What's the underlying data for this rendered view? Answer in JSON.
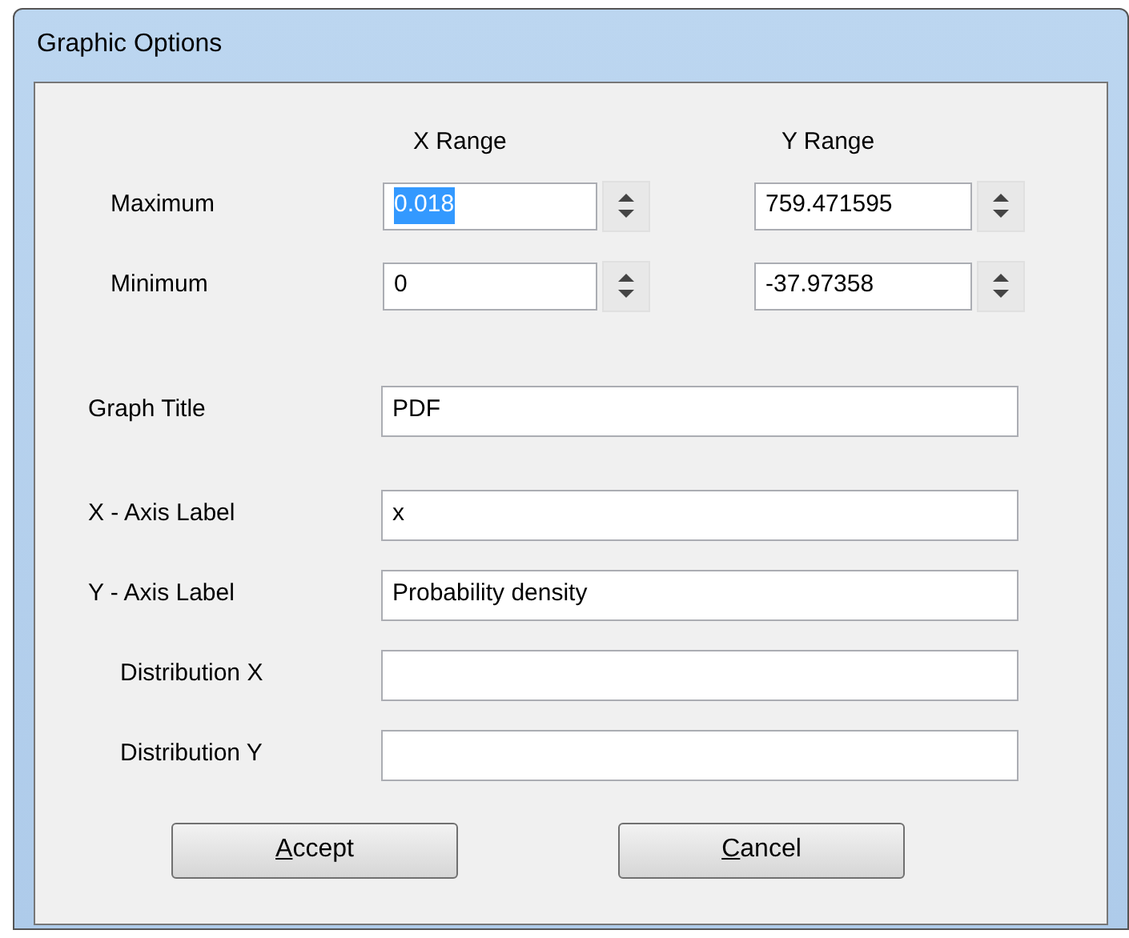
{
  "window": {
    "title": "Graphic Options"
  },
  "range_headers": [
    "X Range",
    "Y Range"
  ],
  "range_rows": [
    {
      "label": "Maximum",
      "x": {
        "value": "0.018",
        "selected": true
      },
      "y": {
        "value": "759.471595",
        "selected": false
      }
    },
    {
      "label": "Minimum",
      "x": {
        "value": "0",
        "selected": false
      },
      "y": {
        "value": "-37.97358",
        "selected": false
      }
    }
  ],
  "fields": [
    {
      "label": "Graph Title",
      "value": "PDF"
    },
    {
      "label": "X - Axis Label",
      "value": "x"
    },
    {
      "label": "Y - Axis Label",
      "value": "Probability density"
    },
    {
      "label": "Distribution X"
    },
    {
      "label": "Distribution Y"
    }
  ],
  "buttons": [
    {
      "mnemonic": "A",
      "label_rest": "ccept"
    },
    {
      "mnemonic": "C",
      "label_rest": "ancel"
    }
  ]
}
